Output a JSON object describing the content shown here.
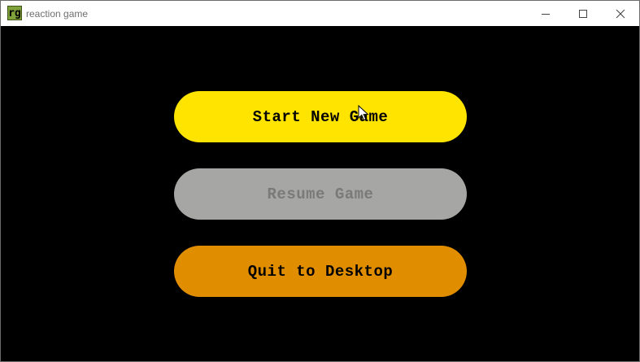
{
  "window": {
    "title": "reaction game",
    "icon_text": "rg",
    "icon_color": "#7fa23a"
  },
  "controls": {
    "minimize": "minimize-icon",
    "maximize": "maximize-icon",
    "close": "close-icon"
  },
  "menu": {
    "start_label": "Start New Game",
    "resume_label": "Resume Game",
    "quit_label": "Quit to Desktop",
    "resume_enabled": false,
    "colors": {
      "start": "#ffe400",
      "resume": "#a6a6a4",
      "quit": "#e08e00",
      "background": "#000000"
    }
  }
}
